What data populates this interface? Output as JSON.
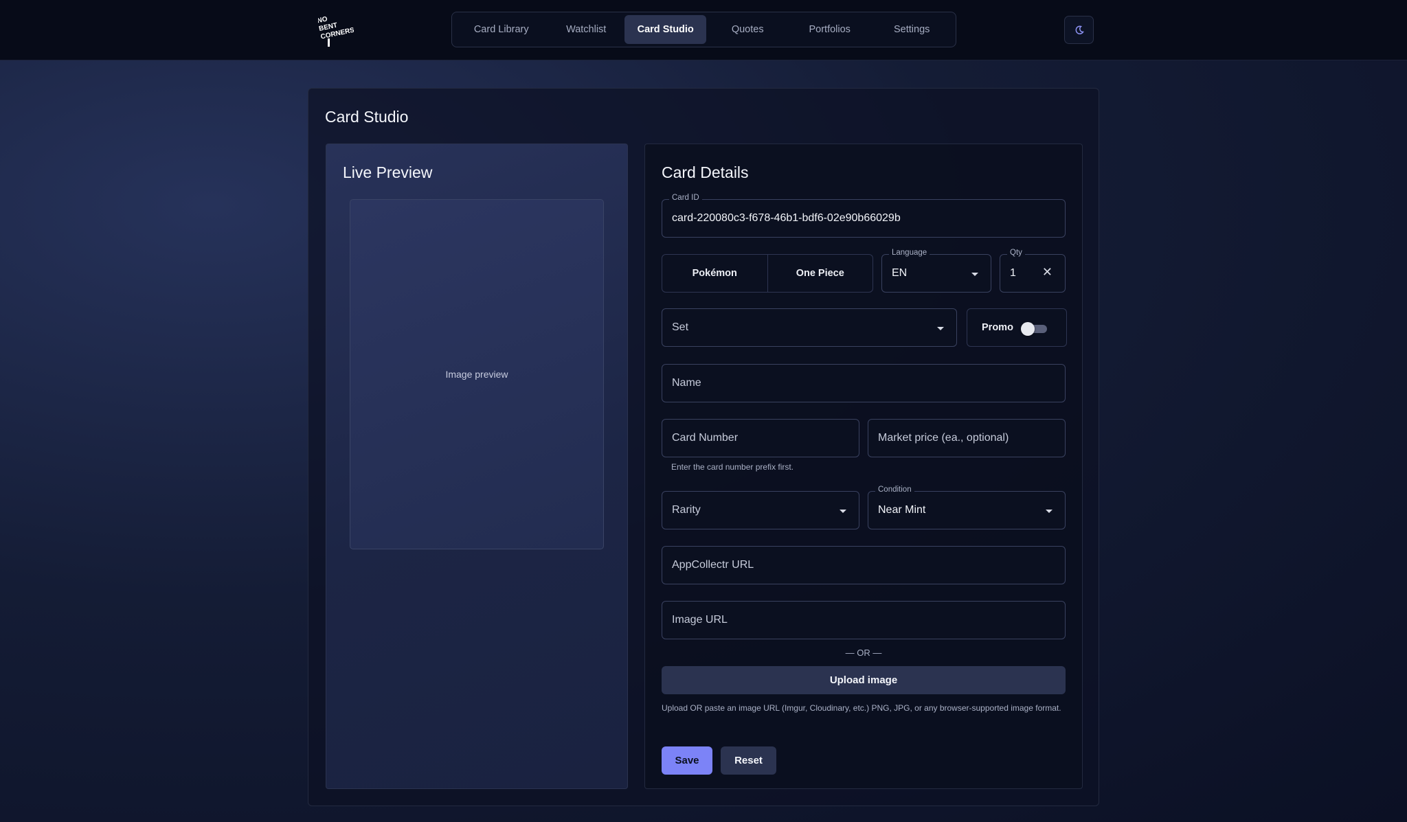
{
  "header": {
    "logo_text": "NO BENT CORNERS",
    "logo_icon": "logo-icon",
    "nav": [
      {
        "label": "Card Library",
        "active": false
      },
      {
        "label": "Watchlist",
        "active": false
      },
      {
        "label": "Card Studio",
        "active": true
      },
      {
        "label": "Quotes",
        "active": false
      },
      {
        "label": "Portfolios",
        "active": false
      },
      {
        "label": "Settings",
        "active": false
      }
    ],
    "theme_icon": "moon-icon"
  },
  "page": {
    "title": "Card Studio"
  },
  "preview": {
    "title": "Live Preview",
    "image_placeholder": "Image preview"
  },
  "details": {
    "title": "Card Details",
    "card_id": {
      "label": "Card ID",
      "value": "card-220080c3-f678-46b1-bdf6-02e90b66029b"
    },
    "game_options": [
      "Pokémon",
      "One Piece"
    ],
    "language": {
      "label": "Language",
      "value": "EN"
    },
    "qty": {
      "label": "Qty",
      "value": "1"
    },
    "set": {
      "placeholder": "Set"
    },
    "promo": {
      "label": "Promo",
      "enabled": false
    },
    "name": {
      "placeholder": "Name"
    },
    "card_number": {
      "placeholder": "Card Number",
      "helper": "Enter the card number prefix first."
    },
    "market_price": {
      "placeholder": "Market price (ea., optional)"
    },
    "rarity": {
      "placeholder": "Rarity"
    },
    "condition": {
      "label": "Condition",
      "value": "Near Mint"
    },
    "appcollectr_url": {
      "placeholder": "AppCollectr URL"
    },
    "image_url": {
      "placeholder": "Image URL"
    },
    "or_divider": "— OR —",
    "upload_label": "Upload image",
    "upload_helper": "Upload OR paste an image URL (Imgur, Cloudinary, etc.) PNG, JPG, or any browser-supported image format.",
    "save_label": "Save",
    "reset_label": "Reset"
  },
  "colors": {
    "accent": "#7c83f7",
    "surface": "#0b1020",
    "button_secondary": "#2b3350"
  }
}
